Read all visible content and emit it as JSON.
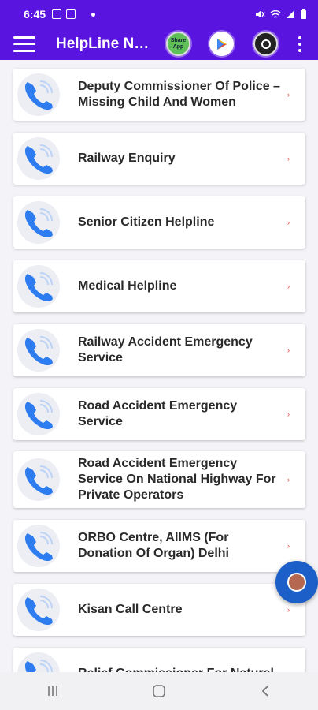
{
  "status_bar": {
    "time": "6:45",
    "icons": [
      "gallery-icon",
      "message-icon",
      "mute-icon",
      "wifi-icon",
      "signal-icon",
      "battery-icon"
    ]
  },
  "app_bar": {
    "title": "HelpLine Numbers",
    "share_label": "Share App",
    "icons": [
      "menu-icon",
      "share-app-icon",
      "play-store-icon",
      "camera-icon",
      "more-vert-icon"
    ]
  },
  "items": [
    {
      "label": "Deputy Commissioner Of Police – Missing Child And Women"
    },
    {
      "label": "Railway Enquiry"
    },
    {
      "label": "Senior Citizen Helpline"
    },
    {
      "label": "Medical Helpline"
    },
    {
      "label": "Railway Accident Emergency Service"
    },
    {
      "label": "Road Accident Emergency Service"
    },
    {
      "label": "Road Accident Emergency Service On National Highway For Private Operators"
    },
    {
      "label": "ORBO Centre, AIIMS (For Donation Of Organ) Delhi"
    },
    {
      "label": "Kisan Call Centre"
    },
    {
      "label": "Relief Commissioner For Natural"
    }
  ],
  "colors": {
    "primary": "#5a14e0",
    "phone_icon": "#2d7cf0",
    "arrow": "#e53935",
    "fab": "#1d5fc8"
  },
  "nav_bar": {
    "icons": [
      "recents-icon",
      "home-icon",
      "back-icon"
    ]
  }
}
